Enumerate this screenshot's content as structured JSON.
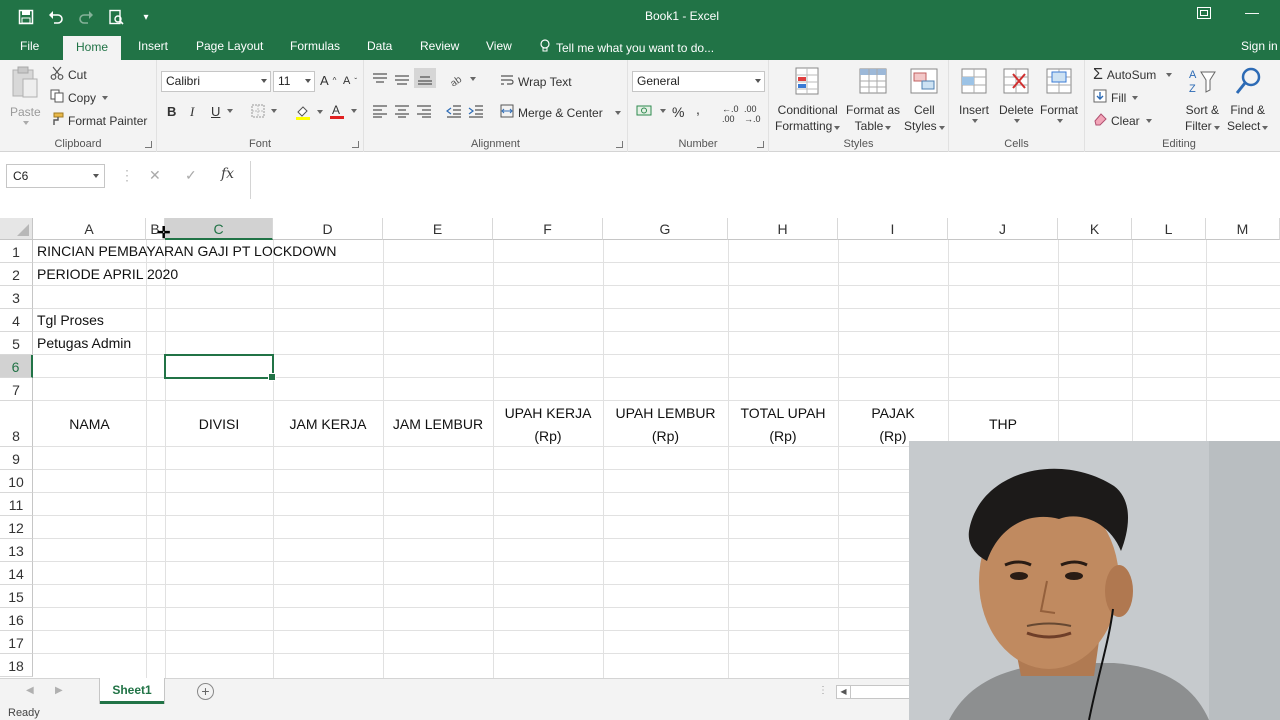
{
  "window": {
    "title": "Book1 - Excel",
    "restore_icon": "restore-icon",
    "minimize_icon": "minimize-icon"
  },
  "quick_access": [
    "save-icon",
    "undo-icon",
    "redo-icon",
    "print-preview-icon",
    "customize-icon"
  ],
  "tabs": [
    {
      "label": "File"
    },
    {
      "label": "Home"
    },
    {
      "label": "Insert"
    },
    {
      "label": "Page Layout"
    },
    {
      "label": "Formulas"
    },
    {
      "label": "Data"
    },
    {
      "label": "Review"
    },
    {
      "label": "View"
    }
  ],
  "tell_me": "Tell me what you want to do...",
  "sign_in": "Sign in",
  "ribbon": {
    "clipboard": {
      "label": "Clipboard",
      "paste": "Paste",
      "cut": "Cut",
      "copy": "Copy",
      "format_painter": "Format Painter"
    },
    "font": {
      "label": "Font",
      "name": "Calibri",
      "size": "11",
      "bold": "B",
      "italic": "I",
      "underline": "U"
    },
    "alignment": {
      "label": "Alignment",
      "wrap_text": "Wrap Text",
      "merge_center": "Merge & Center"
    },
    "number": {
      "label": "Number",
      "format": "General",
      "percent": "%",
      "comma": ","
    },
    "styles": {
      "label": "Styles",
      "conditional_1": "Conditional",
      "conditional_2": "Formatting",
      "format_table_1": "Format as",
      "format_table_2": "Table",
      "cell_styles_1": "Cell",
      "cell_styles_2": "Styles"
    },
    "cells": {
      "label": "Cells",
      "insert": "Insert",
      "delete": "Delete",
      "format": "Format"
    },
    "editing": {
      "label": "Editing",
      "autosum": "AutoSum",
      "fill": "Fill",
      "clear": "Clear",
      "sort_1": "Sort &",
      "sort_2": "Filter",
      "find_1": "Find &",
      "find_2": "Select"
    }
  },
  "formula_bar": {
    "name_box": "C6",
    "fx": "fx",
    "value": ""
  },
  "columns": [
    "A",
    "B",
    "C",
    "D",
    "E",
    "F",
    "G",
    "H",
    "I",
    "J",
    "K",
    "L",
    "M"
  ],
  "rows": [
    "1",
    "2",
    "3",
    "4",
    "5",
    "6",
    "7",
    "8",
    "9",
    "10",
    "11",
    "12",
    "13",
    "14",
    "15",
    "16",
    "17",
    "18"
  ],
  "cells": {
    "a1": "RINCIAN PEMBAYARAN GAJI PT LOCKDOWN",
    "a2": "PERIODE APRIL 2020",
    "a4": "Tgl Proses",
    "a5": "Petugas Admin",
    "a8": "NAMA",
    "c8": "DIVISI",
    "d8": "JAM KERJA",
    "e8": "JAM LEMBUR",
    "f8_1": "UPAH KERJA",
    "f8_2": "(Rp)",
    "g8_1": "UPAH LEMBUR",
    "g8_2": "(Rp)",
    "h8_1": "TOTAL UPAH",
    "h8_2": "(Rp)",
    "i8_1": "PAJAK",
    "i8_2": "(Rp)",
    "j8": "THP"
  },
  "sheets": [
    {
      "label": "Sheet1",
      "active": true
    }
  ],
  "status": "Ready",
  "colors": {
    "accent": "#217346"
  }
}
